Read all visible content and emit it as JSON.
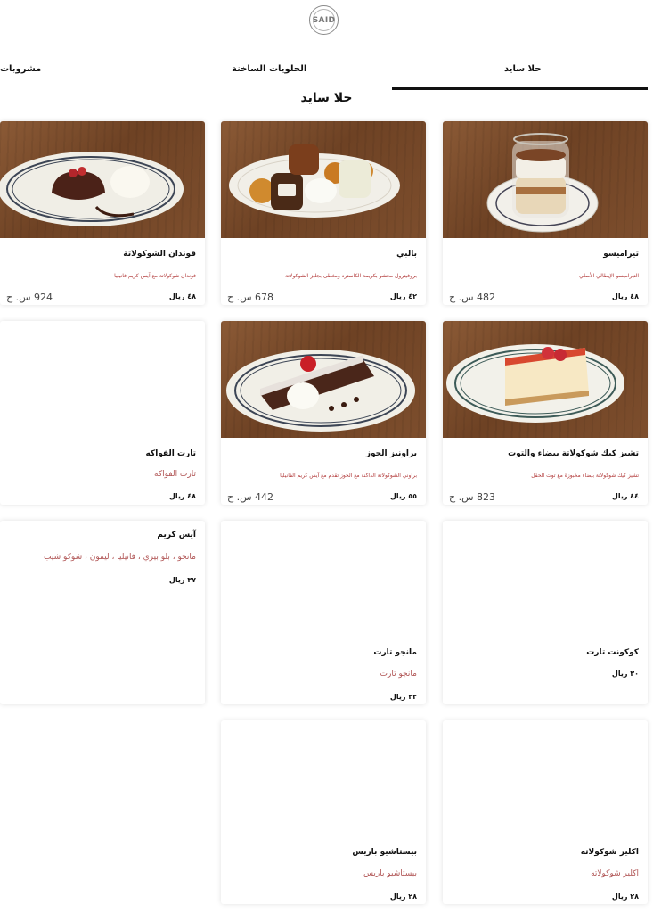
{
  "brand": {
    "logo_text": "SAID"
  },
  "tabs": [
    {
      "label": "حلا سايد",
      "active": true
    },
    {
      "label": "الحلويات الساخنة",
      "active": false
    },
    {
      "label": "مشروبات",
      "active": false
    }
  ],
  "section_title": "حلا سايد",
  "items": [
    {
      "name": "تيراميسو",
      "description": "التيراميسو الإيطالي الأصلي",
      "price": "٤٨ ريال",
      "calories": "482 س. ح",
      "photo": "tiramisu-jar"
    },
    {
      "name": "بالبي",
      "description": "بروفيترول محشو بكريمة الكاسترد ومغطى بجليز الشوكولاتة",
      "price": "٤٢ ريال",
      "calories": "678 س. ح",
      "photo": "profiteroles-platter"
    },
    {
      "name": "فوندان الشوكولاتة",
      "description": "فوندان شوكولاتة مع آيس كريم فانيليا",
      "price": "٤٨ ريال",
      "calories": "924 س. ح",
      "photo": "chocolate-fondant"
    },
    {
      "name": "تشيز كيك شوكولاتة بيضاء والتوت",
      "description": "تشيز كيك شوكولاتة بيضاء مخبوزة مع توت الحقل",
      "price": "٤٤ ريال",
      "calories": "823 س. ح",
      "photo": "berry-cheesecake"
    },
    {
      "name": "براونيز الجوز",
      "description": "براوني الشوكولاتة الداكنة مع الجوز تقدم مع آيس كريم الفانيليا",
      "price": "٥٥ ريال",
      "calories": "442 س. ح",
      "photo": "walnut-brownie"
    },
    {
      "name": "تارت الفواكه",
      "description": "تارت الفواكه",
      "price": "٤٨ ريال"
    },
    {
      "name": "كوكونت تارت",
      "price": "٣٠ ريال"
    },
    {
      "name": "مانجو تارت",
      "description": "مانجو تارت",
      "price": "٣٢ ريال"
    },
    {
      "name": "آيس كريم",
      "description": "مانجو ، بلو بيري ، فانيليا ، ليمون ، شوكو شيب",
      "price": "٣٧ ريال"
    },
    {
      "name": "اكلير شوكولاته",
      "description": "اكلير شوكولاته",
      "price": "٢٨ ريال"
    },
    {
      "name": "بيستاشيو باريس",
      "description": "بيستاشيو باريس",
      "price": "٢٨ ريال"
    }
  ],
  "colors": {
    "accent_text": "#b23b3b",
    "tab_underline": "#111111",
    "card_shadow": "rgba(0,0,0,0.12)"
  }
}
